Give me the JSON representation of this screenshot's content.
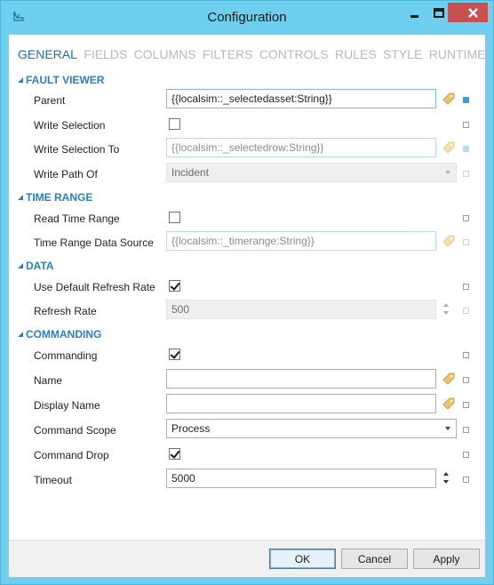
{
  "window": {
    "title": "Configuration"
  },
  "tabs": [
    "GENERAL",
    "FIELDS",
    "COLUMNS",
    "FILTERS",
    "CONTROLS",
    "RULES",
    "STYLE",
    "RUNTIME"
  ],
  "sections": {
    "fault_viewer": {
      "title": "FAULT VIEWER",
      "parent": {
        "label": "Parent",
        "value": "{{localsim::_selectedasset:String}}"
      },
      "write_selection": {
        "label": "Write Selection",
        "checked": false
      },
      "write_selection_to": {
        "label": "Write Selection To",
        "value": "{{localsim::_selectedrow:String}}"
      },
      "write_path_of": {
        "label": "Write Path Of",
        "value": "Incident"
      }
    },
    "time_range": {
      "title": "TIME RANGE",
      "read_time_range": {
        "label": "Read Time Range",
        "checked": false
      },
      "time_range_data_source": {
        "label": "Time Range Data Source",
        "value": "{{localsim::_timerange:String}}"
      }
    },
    "data": {
      "title": "DATA",
      "use_default_refresh_rate": {
        "label": "Use Default Refresh Rate",
        "checked": true
      },
      "refresh_rate": {
        "label": "Refresh Rate",
        "value": "500"
      }
    },
    "commanding": {
      "title": "COMMANDING",
      "commanding": {
        "label": "Commanding",
        "checked": true
      },
      "name": {
        "label": "Name",
        "value": ""
      },
      "display_name": {
        "label": "Display Name",
        "value": ""
      },
      "command_scope": {
        "label": "Command Scope",
        "value": "Process"
      },
      "command_drop": {
        "label": "Command Drop",
        "checked": true
      },
      "timeout": {
        "label": "Timeout",
        "value": "5000"
      }
    }
  },
  "footer": {
    "ok": "OK",
    "cancel": "Cancel",
    "apply": "Apply"
  },
  "colors": {
    "titlebar": "#6ecfee",
    "accent": "#2a7fc2",
    "close": "#c75050"
  }
}
